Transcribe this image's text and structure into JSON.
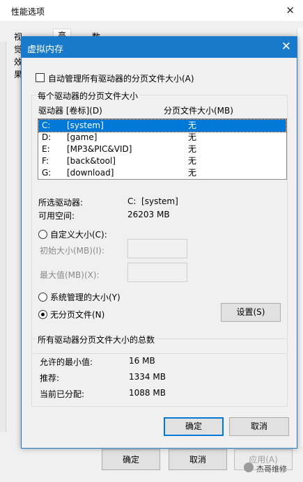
{
  "background_window": {
    "title": "性能选项",
    "tabs": [
      "视觉效果",
      "高级",
      "数据执行保护"
    ],
    "buttons": {
      "ok": "确定",
      "cancel": "取消",
      "apply": "应用(A)"
    }
  },
  "watermark": {
    "text": "杰哥维修"
  },
  "dialog": {
    "title": "虚拟内存",
    "auto_manage_label": "自动管理所有驱动器的分页文件大小(A)",
    "auto_manage_checked": false,
    "drive_group_title": "每个驱动器的分页文件大小",
    "col_drive": "驱动器 [卷标](D)",
    "col_size": "分页文件大小(MB)",
    "drives": [
      {
        "letter": "C:",
        "label": "[system]",
        "size": "无"
      },
      {
        "letter": "D:",
        "label": "[game]",
        "size": "无"
      },
      {
        "letter": "E:",
        "label": "[MP3&PIC&VID]",
        "size": "无"
      },
      {
        "letter": "F:",
        "label": "[back&tool]",
        "size": "无"
      },
      {
        "letter": "G:",
        "label": "[download]",
        "size": "无"
      }
    ],
    "selected_drive_label": "所选驱动器:",
    "selected_drive_value": "C:  [system]",
    "free_space_label": "可用空间:",
    "free_space_value": "26203 MB",
    "custom_size_label": "自定义大小(C):",
    "initial_size_label": "初始大小(MB)(I):",
    "max_size_label": "最大值(MB)(X):",
    "system_managed_label": "系统管理的大小(Y)",
    "no_paging_label": "无分页文件(N)",
    "set_button": "设置(S)",
    "total_group_title": "所有驱动器分页文件大小的总数",
    "min_allowed_label": "允许的最小值:",
    "min_allowed_value": "16 MB",
    "recommended_label": "推荐:",
    "recommended_value": "1334 MB",
    "allocated_label": "当前已分配:",
    "allocated_value": "1088 MB",
    "ok_button": "确定",
    "cancel_button": "取消"
  }
}
